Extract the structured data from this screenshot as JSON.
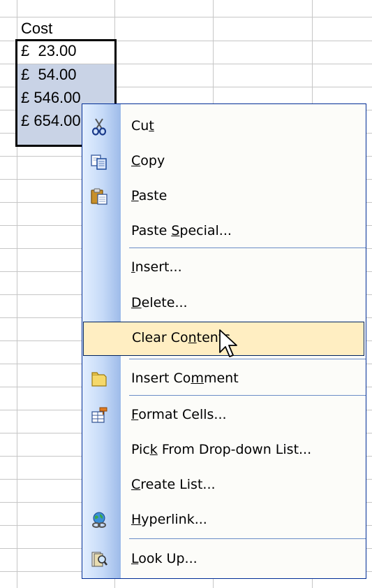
{
  "sheet": {
    "header": "Cost",
    "values": [
      "£  23.00",
      "£  54.00",
      "£ 546.00",
      "£ 654.00"
    ]
  },
  "context_menu": {
    "items": [
      {
        "pre": "Cu",
        "key": "t",
        "post": "",
        "icon": "scissors-icon"
      },
      {
        "pre": "",
        "key": "C",
        "post": "opy",
        "icon": "copy-icon"
      },
      {
        "pre": "",
        "key": "P",
        "post": "aste",
        "icon": "paste-icon"
      },
      {
        "pre": "Paste ",
        "key": "S",
        "post": "pecial...",
        "icon": ""
      },
      {
        "pre": "",
        "key": "I",
        "post": "nsert...",
        "icon": ""
      },
      {
        "pre": "",
        "key": "D",
        "post": "elete...",
        "icon": ""
      },
      {
        "pre": "Clear Co",
        "key": "n",
        "post": "tents",
        "icon": ""
      },
      {
        "pre": "Insert Co",
        "key": "m",
        "post": "ment",
        "icon": "insert-comment-icon"
      },
      {
        "pre": "",
        "key": "F",
        "post": "ormat Cells...",
        "icon": "format-cells-icon"
      },
      {
        "pre": "Pic",
        "key": "k",
        "post": " From Drop-down List...",
        "icon": ""
      },
      {
        "pre": "",
        "key": "C",
        "post": "reate List...",
        "icon": ""
      },
      {
        "pre": "",
        "key": "H",
        "post": "yperlink...",
        "icon": "hyperlink-icon"
      },
      {
        "pre": "",
        "key": "L",
        "post": "ook Up...",
        "icon": "research-icon"
      }
    ],
    "highlighted_index": 6
  },
  "colors": {
    "selection": "#c9d3e6",
    "menu_border": "#002d96",
    "highlight": "#ffeec2"
  }
}
